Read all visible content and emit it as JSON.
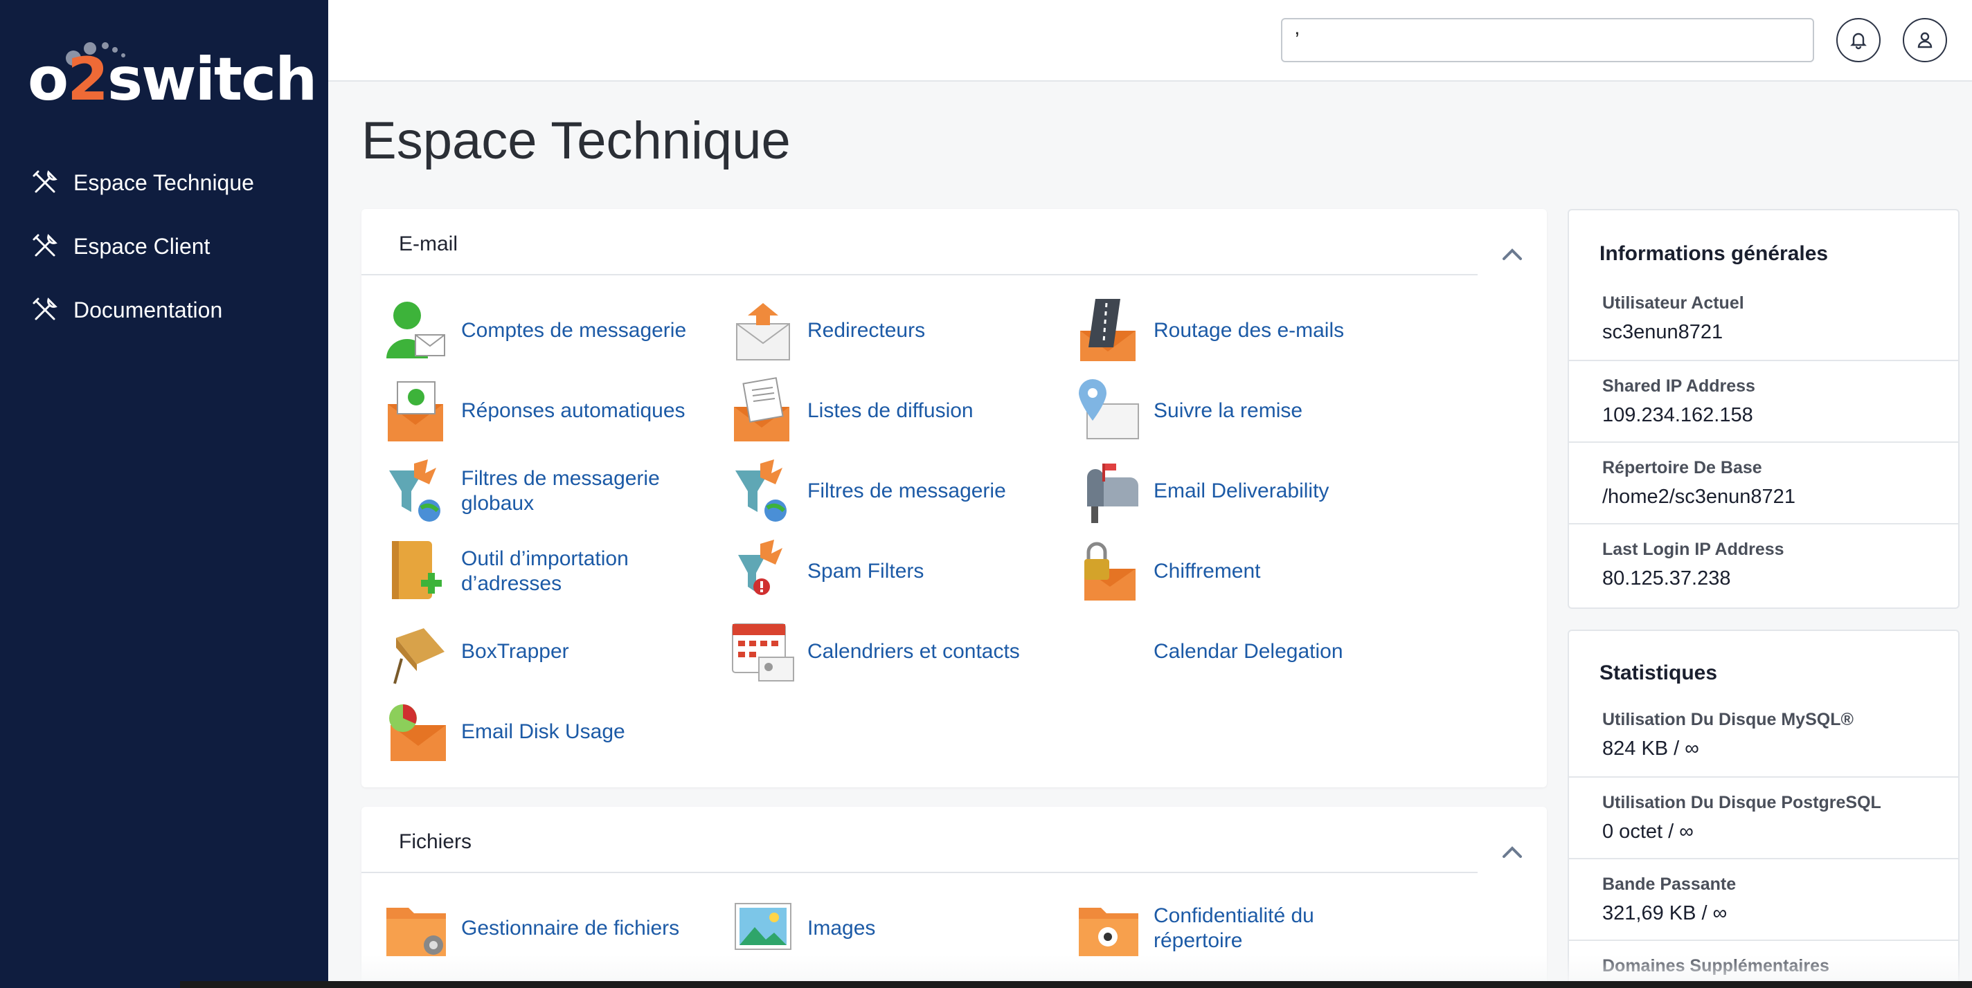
{
  "brand": {
    "logo_text_pre": "o",
    "logo_text_two": "2",
    "logo_text_post": "switch",
    "accent": "#ef6a36",
    "sidebar_bg": "#0f1d3f"
  },
  "sidebar": {
    "items": [
      {
        "label": "Espace Technique",
        "icon": "tools-icon"
      },
      {
        "label": "Espace Client",
        "icon": "tools-icon"
      },
      {
        "label": "Documentation",
        "icon": "tools-icon"
      }
    ]
  },
  "topbar": {
    "search_value": "’",
    "bell_icon": "bell-icon",
    "user_icon": "user-icon"
  },
  "page": {
    "title": "Espace Technique"
  },
  "email_panel": {
    "title": "E-mail",
    "items": [
      {
        "label": "Comptes de messagerie",
        "icon": "email-accounts-icon"
      },
      {
        "label": "Redirecteurs",
        "icon": "forwarders-icon"
      },
      {
        "label": "Routage des e-mails",
        "icon": "email-routing-icon"
      },
      {
        "label": "Réponses automatiques",
        "icon": "autoresponders-icon"
      },
      {
        "label": "Listes de diffusion",
        "icon": "mailing-lists-icon"
      },
      {
        "label": "Suivre la remise",
        "icon": "track-delivery-icon"
      },
      {
        "label": "Filtres de messagerie globaux",
        "icon": "global-filters-icon"
      },
      {
        "label": "Filtres de messagerie",
        "icon": "email-filters-icon"
      },
      {
        "label": "Email Deliverability",
        "icon": "deliverability-icon"
      },
      {
        "label": "Outil d’importation d’adresses",
        "icon": "address-importer-icon"
      },
      {
        "label": "Spam Filters",
        "icon": "spam-filters-icon"
      },
      {
        "label": "Chiffrement",
        "icon": "encryption-icon"
      },
      {
        "label": "BoxTrapper",
        "icon": "boxtrapper-icon"
      },
      {
        "label": "Calendriers et contacts",
        "icon": "calendar-icon"
      },
      {
        "label": "Calendar Delegation",
        "icon": ""
      },
      {
        "label": "Email Disk Usage",
        "icon": "email-disk-usage-icon"
      }
    ]
  },
  "files_panel": {
    "title": "Fichiers",
    "items": [
      {
        "label": "Gestionnaire de fichiers",
        "icon": "file-manager-icon"
      },
      {
        "label": "Images",
        "icon": "images-icon"
      },
      {
        "label": "Confidentialité du répertoire",
        "icon": "directory-privacy-icon"
      }
    ]
  },
  "general_info": {
    "title": "Informations générales",
    "rows": [
      {
        "key": "Utilisateur Actuel",
        "value": "sc3enun8721"
      },
      {
        "key": "Shared IP Address",
        "value": "109.234.162.158"
      },
      {
        "key": "Répertoire De Base",
        "value": "/home2/sc3enun8721"
      },
      {
        "key": "Last Login IP Address",
        "value": "80.125.37.238"
      }
    ]
  },
  "stats": {
    "title": "Statistiques",
    "rows": [
      {
        "key": "Utilisation Du Disque MySQL®",
        "value": "824 KB / ∞"
      },
      {
        "key": "Utilisation Du Disque PostgreSQL",
        "value": "0 octet / ∞"
      },
      {
        "key": "Bande Passante",
        "value": "321,69 KB / ∞"
      },
      {
        "key": "Domaines Supplémentaires",
        "value": ""
      }
    ]
  }
}
